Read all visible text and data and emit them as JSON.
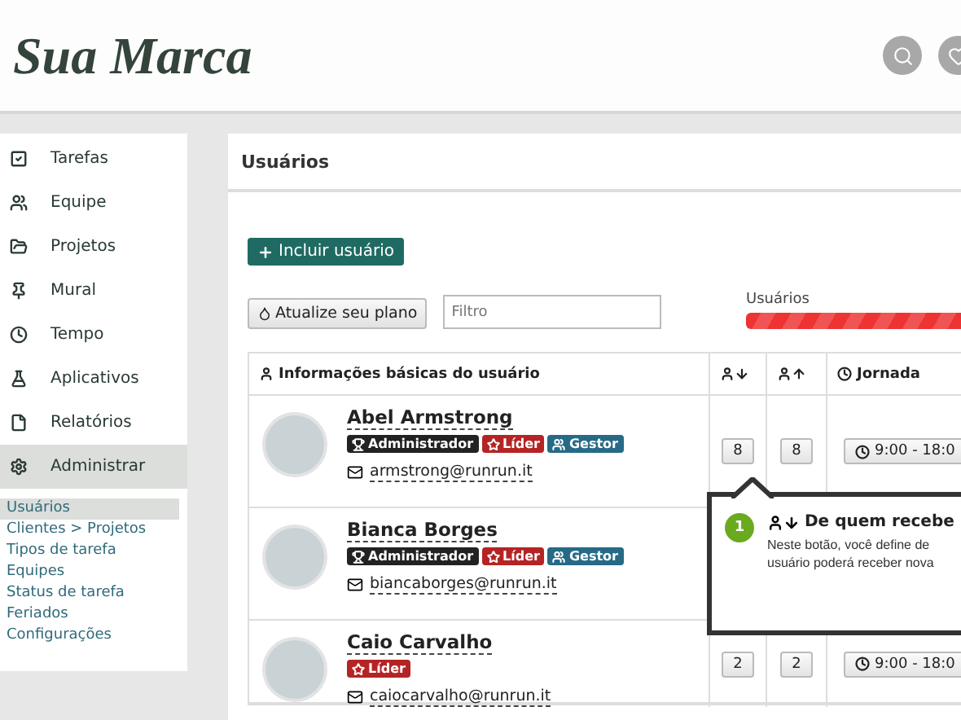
{
  "header": {
    "brand": "Sua Marca"
  },
  "sidebar": {
    "items": [
      {
        "label": "Tarefas",
        "selected": false
      },
      {
        "label": "Equipe",
        "selected": false
      },
      {
        "label": "Projetos",
        "selected": false
      },
      {
        "label": "Mural",
        "selected": false
      },
      {
        "label": "Tempo",
        "selected": false
      },
      {
        "label": "Aplicativos",
        "selected": false
      },
      {
        "label": "Relatórios",
        "selected": false
      },
      {
        "label": "Administrar",
        "selected": true
      }
    ],
    "subitems": [
      {
        "label": "Usuários",
        "selected": true
      },
      {
        "label": "Clientes > Projetos",
        "selected": false
      },
      {
        "label": "Tipos de tarefa",
        "selected": false
      },
      {
        "label": "Equipes",
        "selected": false
      },
      {
        "label": "Status de tarefa",
        "selected": false
      },
      {
        "label": "Feriados",
        "selected": false
      },
      {
        "label": "Configurações",
        "selected": false
      }
    ]
  },
  "main": {
    "title": "Usuários",
    "add_button": "Incluir usuário",
    "upgrade_button": "Atualize seu plano",
    "filter": {
      "placeholder": "Filtro"
    },
    "usage": {
      "label": "Usuários",
      "level": 1
    },
    "table": {
      "columns": [
        {
          "label": "Informações básicas do usuário"
        },
        {},
        {},
        {
          "label": "Jornada"
        }
      ],
      "rows": [
        {
          "name": "Abel Armstrong",
          "badges": [
            {
              "label": "Administrador",
              "kind": "admin"
            },
            {
              "label": "Líder",
              "kind": "leader"
            },
            {
              "label": "Gestor",
              "kind": "manager"
            }
          ],
          "email": "armstrong@runrun.it",
          "received": "8",
          "sent": "8",
          "schedule": "9:00 - 18:0"
        },
        {
          "name": "Bianca Borges",
          "badges": [
            {
              "label": "Administrador",
              "kind": "admin"
            },
            {
              "label": "Líder",
              "kind": "leader"
            },
            {
              "label": "Gestor",
              "kind": "manager"
            }
          ],
          "email": "biancaborges@runrun.it"
        },
        {
          "name": "Caio Carvalho",
          "badges": [
            {
              "label": "Líder",
              "kind": "leader"
            }
          ],
          "email": "caiocarvalho@runrun.it",
          "received": "2",
          "sent": "2",
          "schedule": "9:00 - 18:0"
        }
      ]
    },
    "tooltip": {
      "step": "1",
      "title": "De quem recebe",
      "lines": [
        "Neste botão, você define de",
        "usuário poderá receber nova"
      ]
    }
  }
}
